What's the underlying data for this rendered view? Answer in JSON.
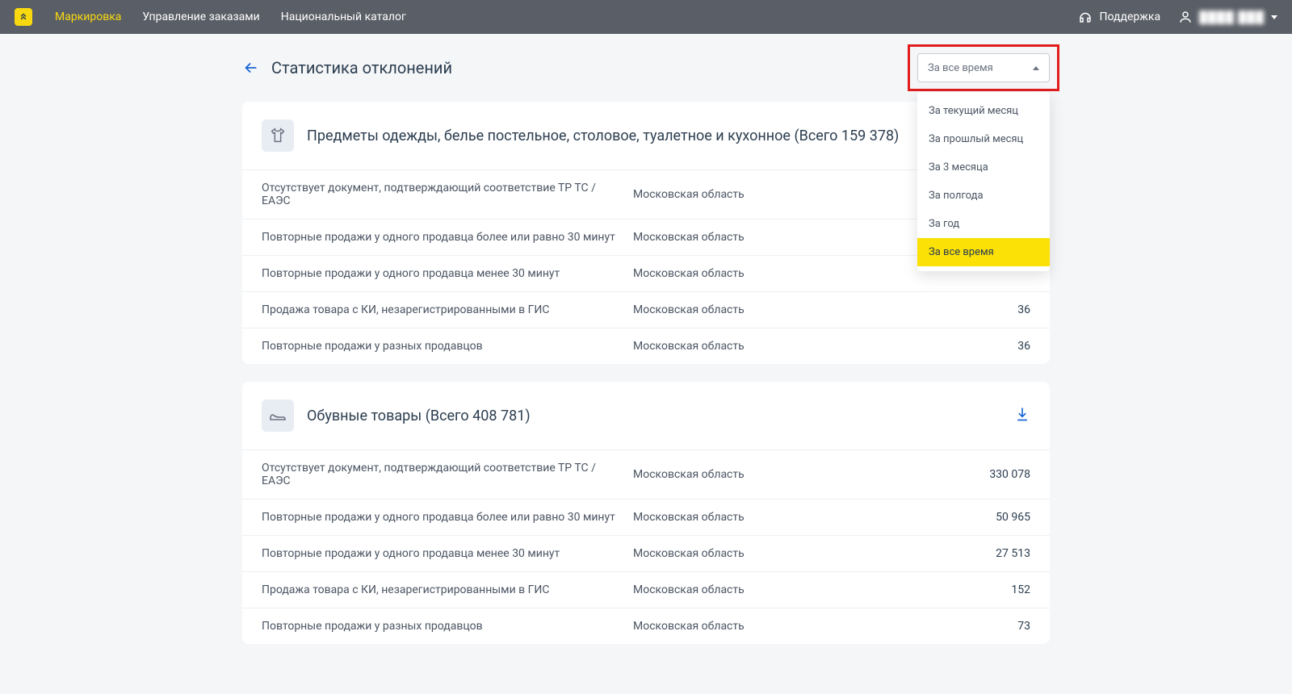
{
  "header": {
    "nav": [
      {
        "label": "Маркировка",
        "active": true
      },
      {
        "label": "Управление заказами",
        "active": false
      },
      {
        "label": "Национальный каталог",
        "active": false
      }
    ],
    "support": "Поддержка",
    "user": "████ ███"
  },
  "page": {
    "title": "Статистика отклонений"
  },
  "filter": {
    "selected": "За все время",
    "options": [
      "За текущий месяц",
      "За прошлый месяц",
      "За 3 месяца",
      "За полгода",
      "За год",
      "За все время"
    ]
  },
  "categories": [
    {
      "icon": "shirt",
      "title": "Предметы одежды, белье постельное, столовое, туалетное и кухонное (Всего 159 378)",
      "download": false,
      "rows": [
        {
          "desc": "Отсутствует документ, подтверждающий соответствие ТР ТС / ЕАЭС",
          "region": "Московская область",
          "count": ""
        },
        {
          "desc": "Повторные продажи у одного продавца более или равно 30 минут",
          "region": "Московская область",
          "count": ""
        },
        {
          "desc": "Повторные продажи у одного продавца менее 30 минут",
          "region": "Московская область",
          "count": ""
        },
        {
          "desc": "Продажа товара с КИ, незарегистрированными в ГИС",
          "region": "Московская область",
          "count": "36"
        },
        {
          "desc": "Повторные продажи у разных продавцов",
          "region": "Московская область",
          "count": "36"
        }
      ]
    },
    {
      "icon": "shoe",
      "title": "Обувные товары (Всего 408 781)",
      "download": true,
      "rows": [
        {
          "desc": "Отсутствует документ, подтверждающий соответствие ТР ТС / ЕАЭС",
          "region": "Московская область",
          "count": "330 078"
        },
        {
          "desc": "Повторные продажи у одного продавца более или равно 30 минут",
          "region": "Московская область",
          "count": "50 965"
        },
        {
          "desc": "Повторные продажи у одного продавца менее 30 минут",
          "region": "Московская область",
          "count": "27 513"
        },
        {
          "desc": "Продажа товара с КИ, незарегистрированными в ГИС",
          "region": "Московская область",
          "count": "152"
        },
        {
          "desc": "Повторные продажи у разных продавцов",
          "region": "Московская область",
          "count": "73"
        }
      ]
    }
  ]
}
